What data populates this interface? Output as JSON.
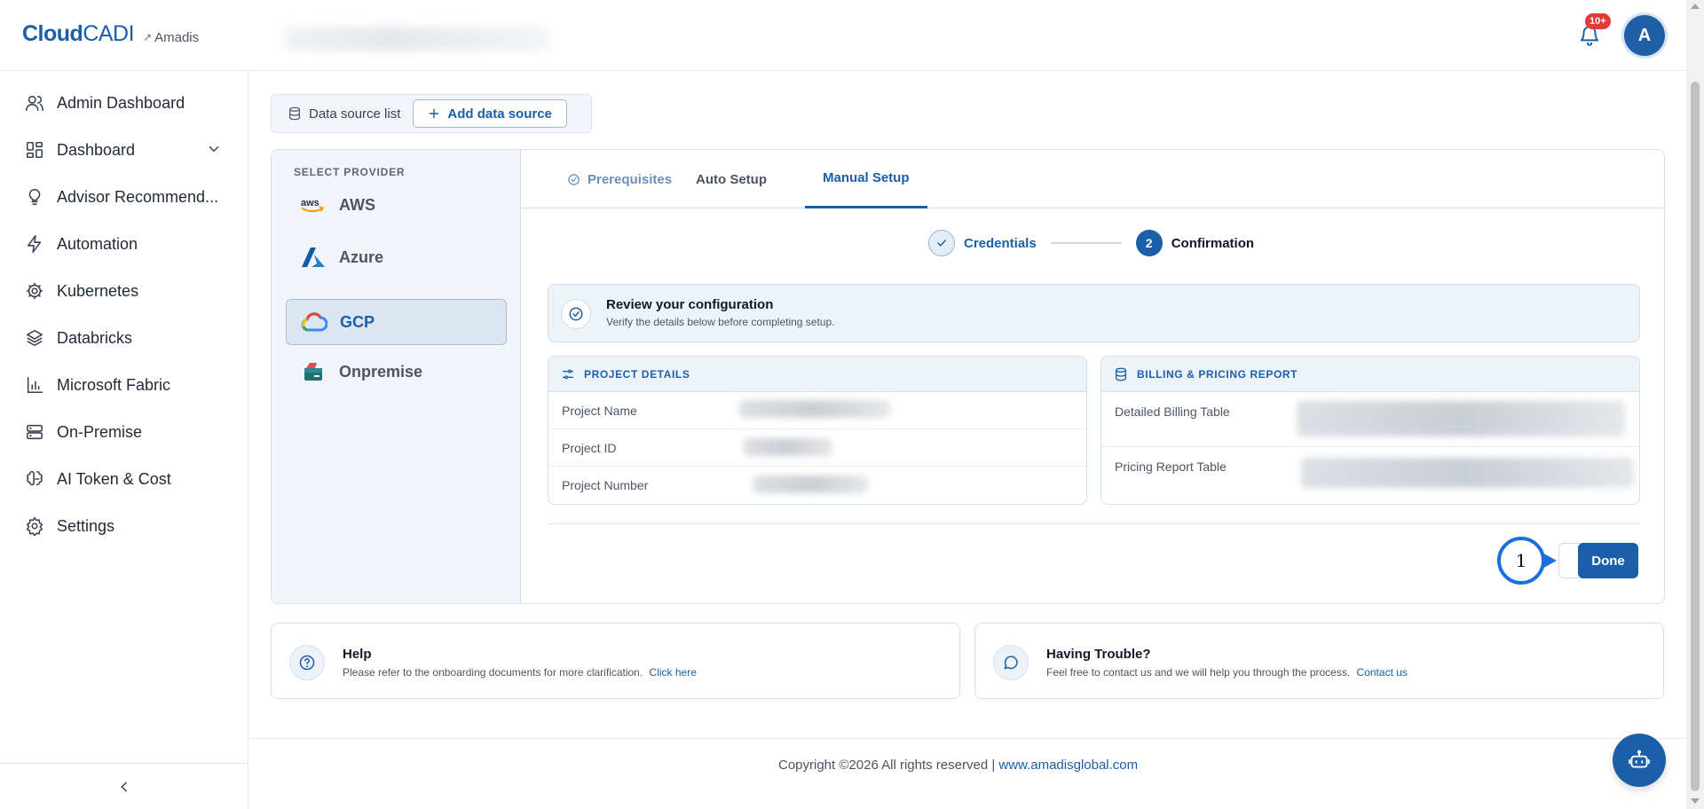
{
  "header": {
    "logo_bold": "Cloud",
    "logo_light": "CADI",
    "tenant": "Amadis",
    "notification_badge": "10+",
    "avatar_initial": "A"
  },
  "sidebar": {
    "items": [
      {
        "label": "Admin Dashboard",
        "icon": "users-icon"
      },
      {
        "label": "Dashboard",
        "icon": "dashboard-icon"
      },
      {
        "label": "Advisor Recommend...",
        "icon": "lightbulb-icon"
      },
      {
        "label": "Automation",
        "icon": "bolt-icon"
      },
      {
        "label": "Kubernetes",
        "icon": "helm-icon"
      },
      {
        "label": "Databricks",
        "icon": "layers-icon"
      },
      {
        "label": "Microsoft Fabric",
        "icon": "bar-chart-icon"
      },
      {
        "label": "On-Premise",
        "icon": "server-icon"
      },
      {
        "label": "AI Token & Cost",
        "icon": "brain-icon"
      },
      {
        "label": "Settings",
        "icon": "gear-icon"
      }
    ]
  },
  "toolbar": {
    "list_label": "Data source list",
    "add_label": "Add data source"
  },
  "providers": {
    "title": "SELECT PROVIDER",
    "items": [
      "AWS",
      "Azure",
      "GCP",
      "Onpremise"
    ],
    "selected": "GCP"
  },
  "tabs": {
    "prerequisites": "Prerequisites",
    "auto": "Auto Setup",
    "manual": "Manual Setup"
  },
  "stepper": {
    "step1": "Credentials",
    "step2_number": "2",
    "step2": "Confirmation"
  },
  "review": {
    "title": "Review your configuration",
    "subtitle": "Verify the details below before completing setup."
  },
  "project": {
    "heading": "PROJECT DETAILS",
    "rows": [
      "Project Name",
      "Project ID",
      "Project Number"
    ]
  },
  "billing": {
    "heading": "BILLING & PRICING REPORT",
    "rows": [
      "Detailed Billing Table",
      "Pricing Report Table"
    ]
  },
  "actions": {
    "done": "Done",
    "marker": "1"
  },
  "help": {
    "title": "Help",
    "text": "Please refer to the onboarding documents for more clarification.",
    "link": "Click here"
  },
  "trouble": {
    "title": "Having Trouble?",
    "text": "Feel free to contact us and we will help you through the process.",
    "link": "Contact us"
  },
  "footer": {
    "copyright": "Copyright ©2026 All rights reserved |",
    "link": "www.amadisglobal.com"
  },
  "colors": {
    "brand": "#1a5fa7",
    "badge": "#e53935",
    "marker": "#1a6fe0"
  }
}
